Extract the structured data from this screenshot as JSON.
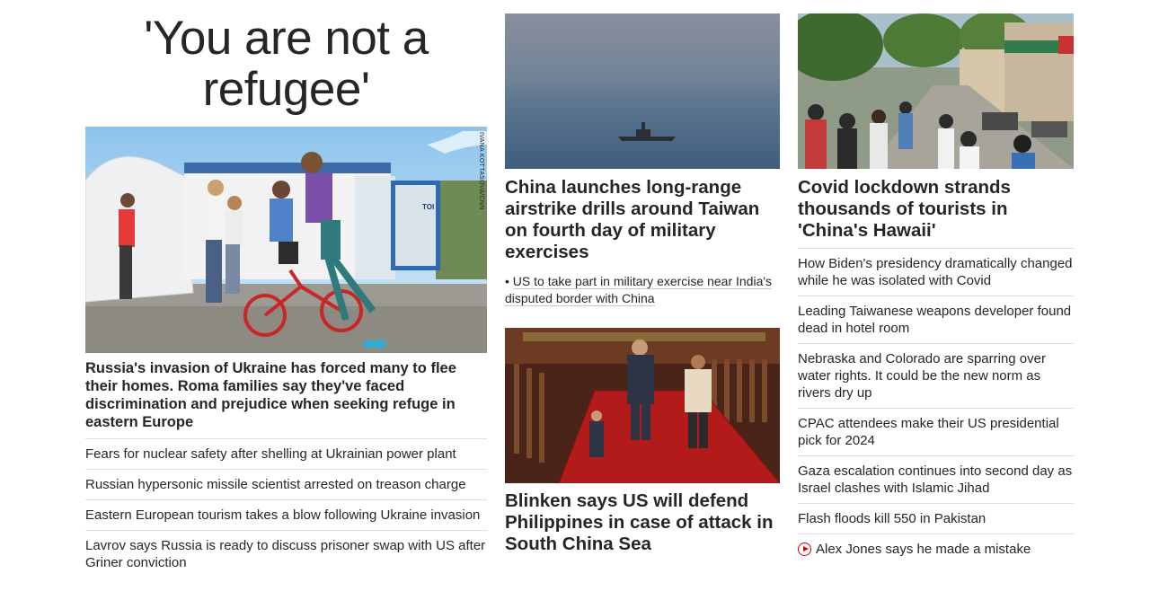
{
  "left": {
    "headline": "'You are not a refugee'",
    "image_credit": "IVANA KOTTASOVA/CNN",
    "lead_text": "Russia's invasion of Ukraine has forced many to flee their homes. Roma families say they've faced discrimination and prejudice when seeking refuge in eastern Europe",
    "items": [
      {
        "label": "Fears for nuclear safety after shelling at Ukrainian power plant"
      },
      {
        "label": "Russian hypersonic missile scientist arrested on treason charge"
      },
      {
        "label": "Eastern European tourism takes a blow following Ukraine invasion"
      },
      {
        "label": "Lavrov says Russia is ready to discuss prisoner swap with US after Griner conviction"
      }
    ]
  },
  "middle": {
    "story1": {
      "title": "China launches long-range airstrike drills around Taiwan on fourth day of military exercises",
      "sub_link": "US to take part in military exercise near India's disputed border with China"
    },
    "story2": {
      "title": "Blinken says US will defend Philippines in case of attack in South China Sea"
    }
  },
  "right": {
    "title": "Covid lockdown strands thousands of tourists in 'China's Hawaii'",
    "items": [
      {
        "label": "How Biden's presidency dramatically changed while he was isolated with Covid"
      },
      {
        "label": "Leading Taiwanese weapons developer found dead in hotel room"
      },
      {
        "label": "Nebraska and Colorado are sparring over water rights. It could be the new norm as rivers dry up"
      },
      {
        "label": "CPAC attendees make their US presidential pick for 2024"
      },
      {
        "label": "Gaza escalation continues into second day as Israel clashes with Islamic Jihad"
      },
      {
        "label": "Flash floods kill 550 in Pakistan"
      },
      {
        "label": "Alex Jones says he made a mistake",
        "icon": "play-video-icon"
      }
    ]
  },
  "colors": {
    "text": "#262626",
    "divider": "#dedede",
    "video_accent": "#cc0000"
  }
}
